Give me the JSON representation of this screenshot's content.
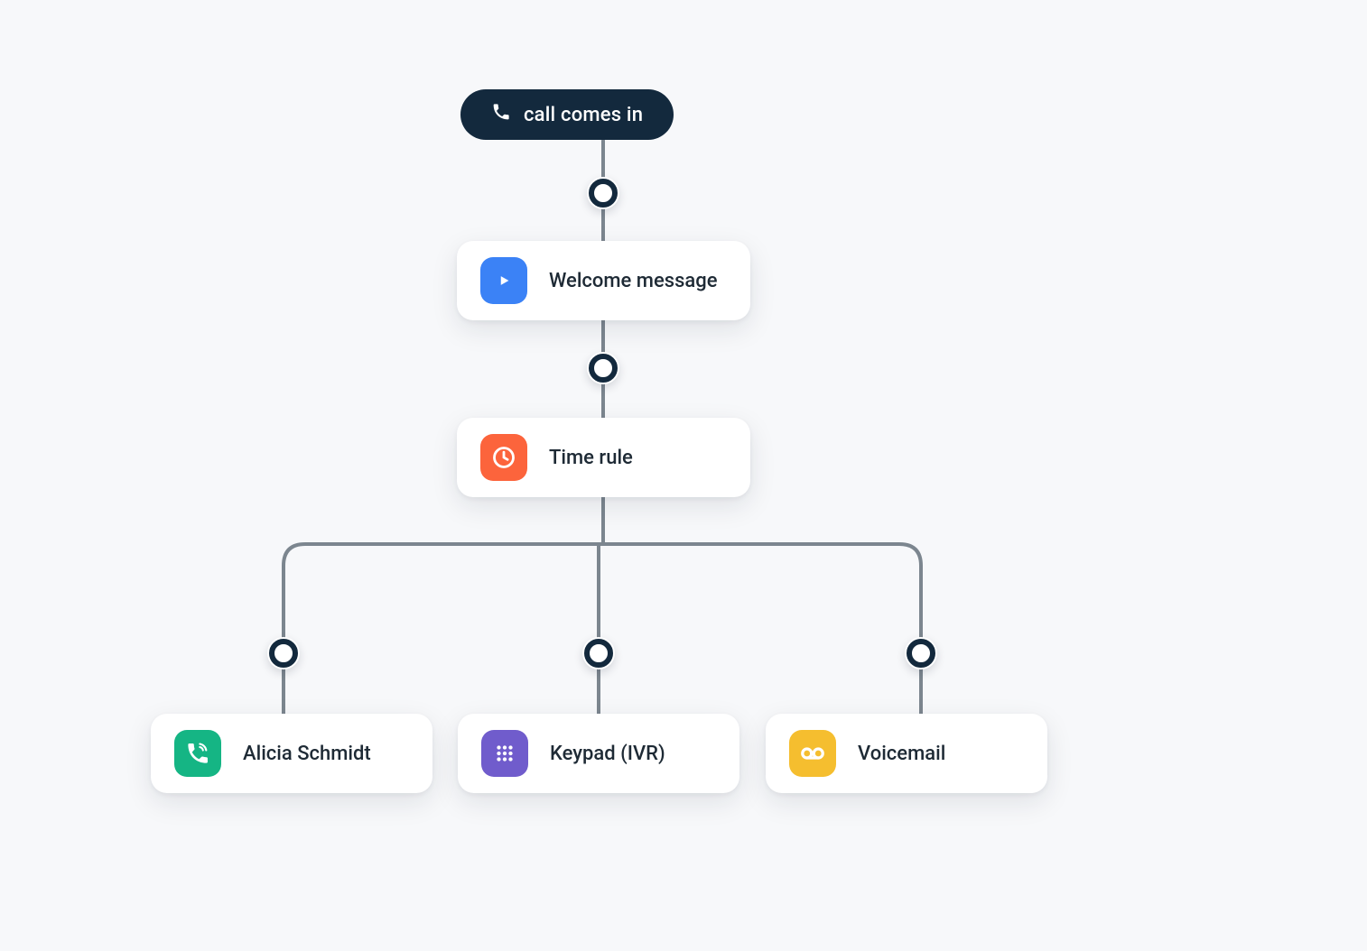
{
  "root": {
    "label": "call comes in",
    "icon": "phone-icon"
  },
  "steps": {
    "welcome": {
      "label": "Welcome message",
      "icon": "play-icon",
      "icon_color": "#3b82f6"
    },
    "timerule": {
      "label": "Time rule",
      "icon": "clock-icon",
      "icon_color": "#fc643c"
    }
  },
  "branches": [
    {
      "key": "alicia",
      "label": "Alicia Schmidt",
      "icon": "call-agent-icon",
      "icon_color": "#15b584"
    },
    {
      "key": "keypad",
      "label": "Keypad (IVR)",
      "icon": "keypad-icon",
      "icon_color": "#705ccc"
    },
    {
      "key": "voicemail",
      "label": "Voicemail",
      "icon": "voicemail-icon",
      "icon_color": "#f5be2f"
    }
  ],
  "colors": {
    "background": "#f7f8fa",
    "node_dark": "#13293d",
    "line": "#7c868f"
  }
}
